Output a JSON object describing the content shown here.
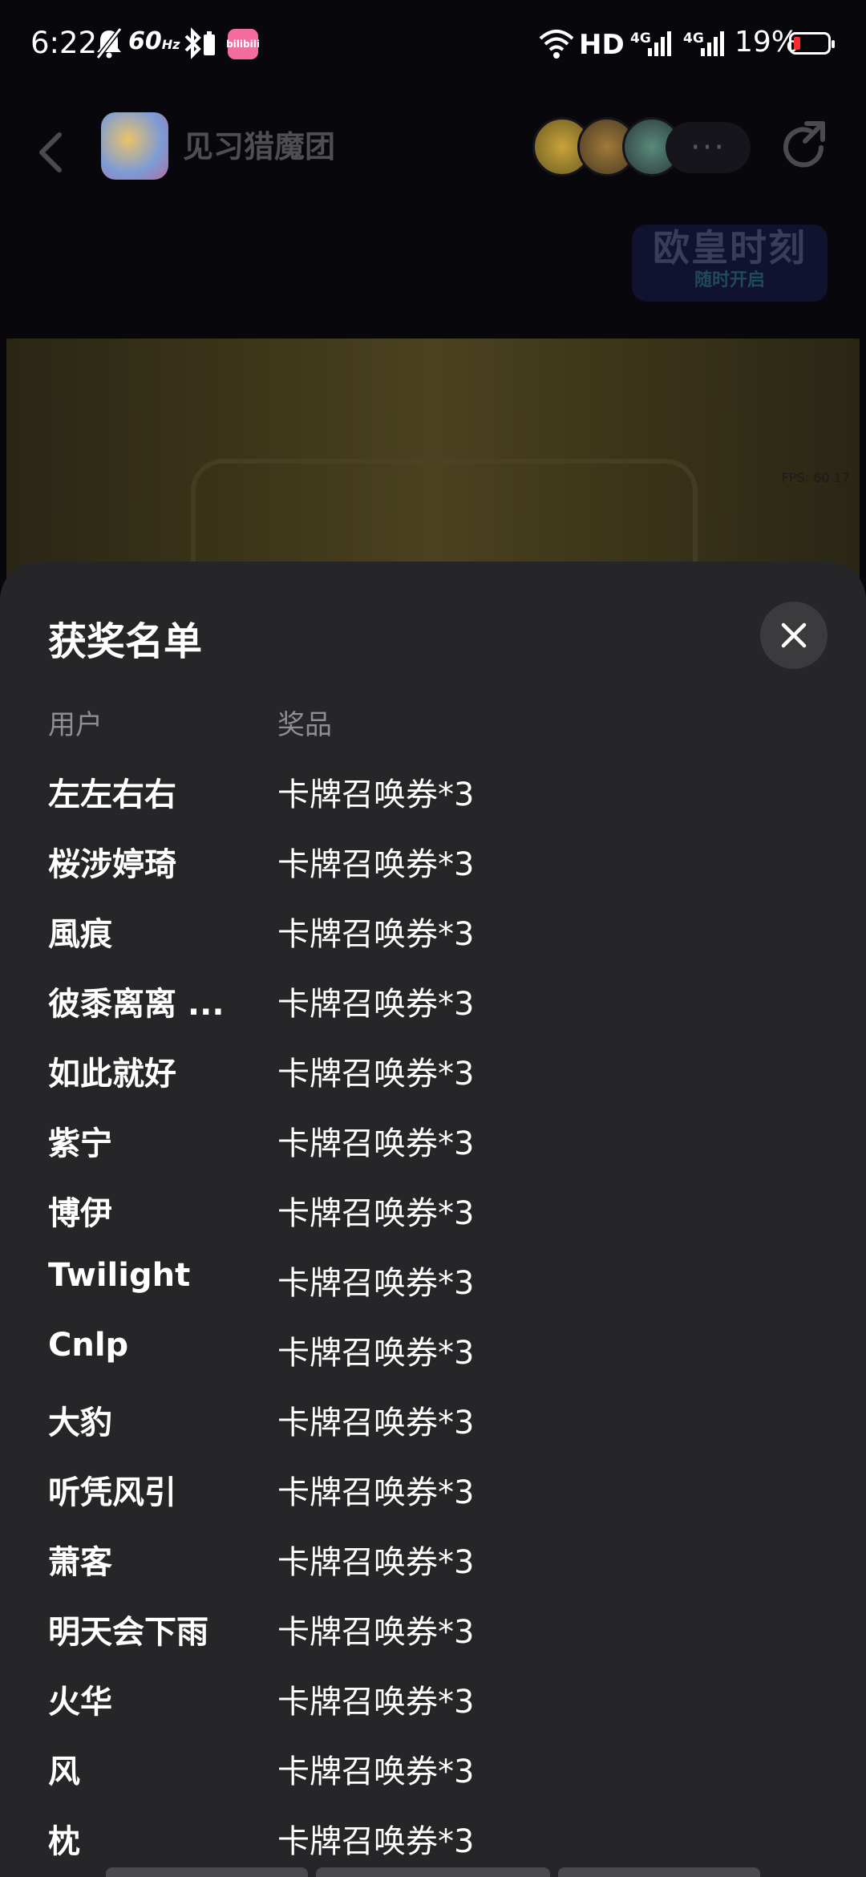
{
  "status_bar": {
    "time": "6:22",
    "refresh_rate": "60",
    "refresh_unit": "Hz",
    "bili_app": "bilibili",
    "hd_label": "HD",
    "net1": "4G",
    "net2": "4G",
    "battery_percent": "19%",
    "battery_level": 0.19
  },
  "header": {
    "game_title": "见习猎魔团",
    "more_label": "···",
    "event_badge": {
      "title": "欧皇时刻",
      "subtitle": "随时开启"
    }
  },
  "game_area": {
    "fps_text": "FPS: 60.17"
  },
  "sheet": {
    "title": "获奖名单",
    "columns": {
      "user": "用户",
      "prize": "奖品"
    },
    "rows": [
      {
        "user": "左左右右",
        "prize": "卡牌召唤券*3"
      },
      {
        "user": "桜涉婷琦",
        "prize": "卡牌召唤券*3"
      },
      {
        "user": "風痕",
        "prize": "卡牌召唤券*3"
      },
      {
        "user": "彼黍离离 ...",
        "prize": "卡牌召唤券*3"
      },
      {
        "user": "如此就好",
        "prize": "卡牌召唤券*3"
      },
      {
        "user": "紫宁",
        "prize": "卡牌召唤券*3"
      },
      {
        "user": "博伊",
        "prize": "卡牌召唤券*3"
      },
      {
        "user": "Twilight",
        "prize": "卡牌召唤券*3"
      },
      {
        "user": "Cnlp",
        "prize": "卡牌召唤券*3"
      },
      {
        "user": "大豹",
        "prize": "卡牌召唤券*3"
      },
      {
        "user": "听凭风引",
        "prize": "卡牌召唤券*3"
      },
      {
        "user": "萧客",
        "prize": "卡牌召唤券*3"
      },
      {
        "user": "明天会下雨",
        "prize": "卡牌召唤券*3"
      },
      {
        "user": "火华",
        "prize": "卡牌召唤券*3"
      },
      {
        "user": "风",
        "prize": "卡牌召唤券*3"
      },
      {
        "user": "枕",
        "prize": "卡牌召唤券*3"
      }
    ]
  },
  "colors": {
    "sheet_bg": "#262628",
    "close_bg": "#3b3b3e",
    "battery_low": "#ff2a2a",
    "bili_pink": "#f46b9d"
  }
}
